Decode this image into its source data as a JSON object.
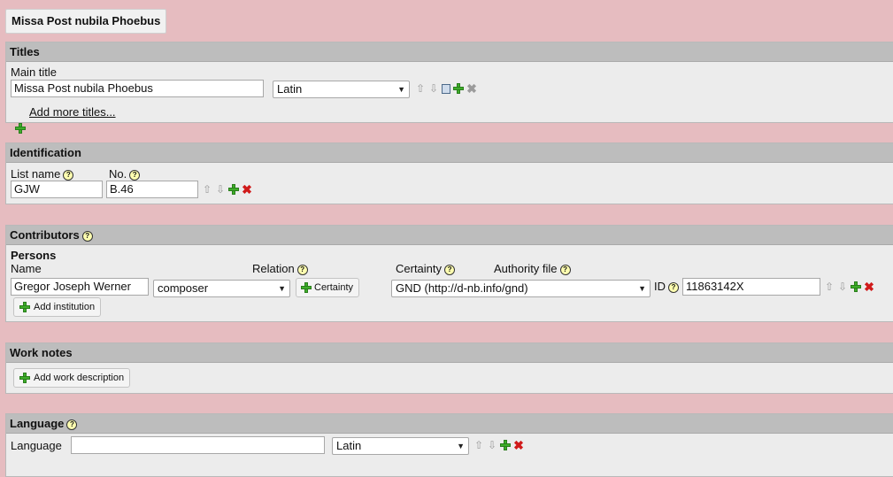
{
  "page_title": "Missa Post nubila Phoebus",
  "titles": {
    "header": "Titles",
    "main_title_label": "Main title",
    "main_title_value": "Missa Post nubila Phoebus",
    "language_value": "Latin",
    "add_more_label": "Add more titles..."
  },
  "identification": {
    "header": "Identification",
    "list_name_label": "List name",
    "no_label": "No.",
    "list_name_value": "GJW",
    "no_value": "B.46"
  },
  "contributors": {
    "header": "Contributors",
    "persons_label": "Persons",
    "name_label": "Name",
    "relation_label": "Relation",
    "certainty_label": "Certainty",
    "authority_file_label": "Authority file",
    "name_value": "Gregor Joseph Werner",
    "relation_value": "composer",
    "certainty_button": "Certainty",
    "authority_value": "GND (http://d-nb.info/gnd)",
    "id_label": "ID",
    "id_value": "11863142X",
    "add_institution": "Add institution"
  },
  "work_notes": {
    "header": "Work notes",
    "add_description": "Add work description"
  },
  "language": {
    "header": "Language",
    "label": "Language",
    "value": "",
    "select_value": "Latin"
  },
  "help_glyph": "?",
  "icons": {
    "up": "⇧",
    "down": "⇩",
    "remove": "✖"
  }
}
